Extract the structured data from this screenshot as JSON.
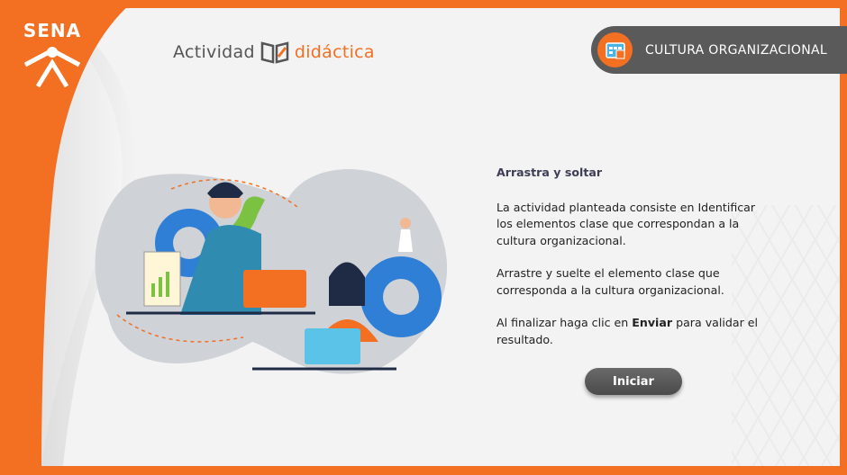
{
  "brand": {
    "logo_text": "SENA",
    "color_orange": "#f36f21",
    "color_dark": "#5a5a5a"
  },
  "header": {
    "activity_word": "Actividad",
    "didactic_word": "didáctica",
    "topic_badge": "CULTURA ORGANIZACIONAL",
    "topic_icon": "calendar-board-icon"
  },
  "content": {
    "heading": "Arrastra y soltar",
    "paragraph1": "La actividad planteada consiste en Identificar los elementos clase que correspondan a la cultura organizacional.",
    "paragraph2": "Arrastre y suelte el elemento clase que corresponda a la cultura organizacional.",
    "paragraph3_before": "Al finalizar haga clic en ",
    "paragraph3_bold": "Enviar",
    "paragraph3_after": " para validar el resultado."
  },
  "actions": {
    "start_label": "Iniciar"
  },
  "illustration": {
    "icon": "team-work-gears-illustration"
  }
}
